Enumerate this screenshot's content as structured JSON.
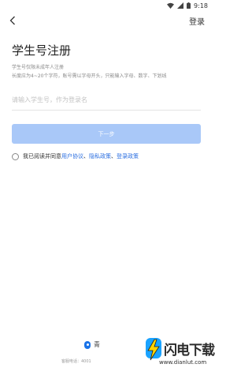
{
  "status_bar": {
    "time": "9:18",
    "icons": [
      "wifi-icon",
      "signal-icon",
      "battery-icon"
    ]
  },
  "header": {
    "back_icon": "chevron-left-icon",
    "login_label": "登录"
  },
  "form": {
    "title": "学生号注册",
    "hint_1": "学生号仅限未成年人注册",
    "hint_2": "长度应为4~20个字符，账号需以字母开头，只能输入字母、数字、下划线",
    "username_placeholder": "请输入学生号，作为登录名",
    "username_value": "",
    "next_label": "下一步",
    "next_color": "#a9c8f8"
  },
  "agreement": {
    "prefix": "我已阅读并同意",
    "user_agreement": "用户协议",
    "sep_1": "、",
    "privacy_policy": "隐私政策",
    "sep_2": "、",
    "login_policy": "登录政策",
    "checked": false,
    "link_color": "#2a6ee0"
  },
  "footer": {
    "company": "青",
    "phone": "客服电话：4001"
  },
  "watermark": {
    "title": "闪电下载",
    "url": "www.dianlut.com"
  }
}
